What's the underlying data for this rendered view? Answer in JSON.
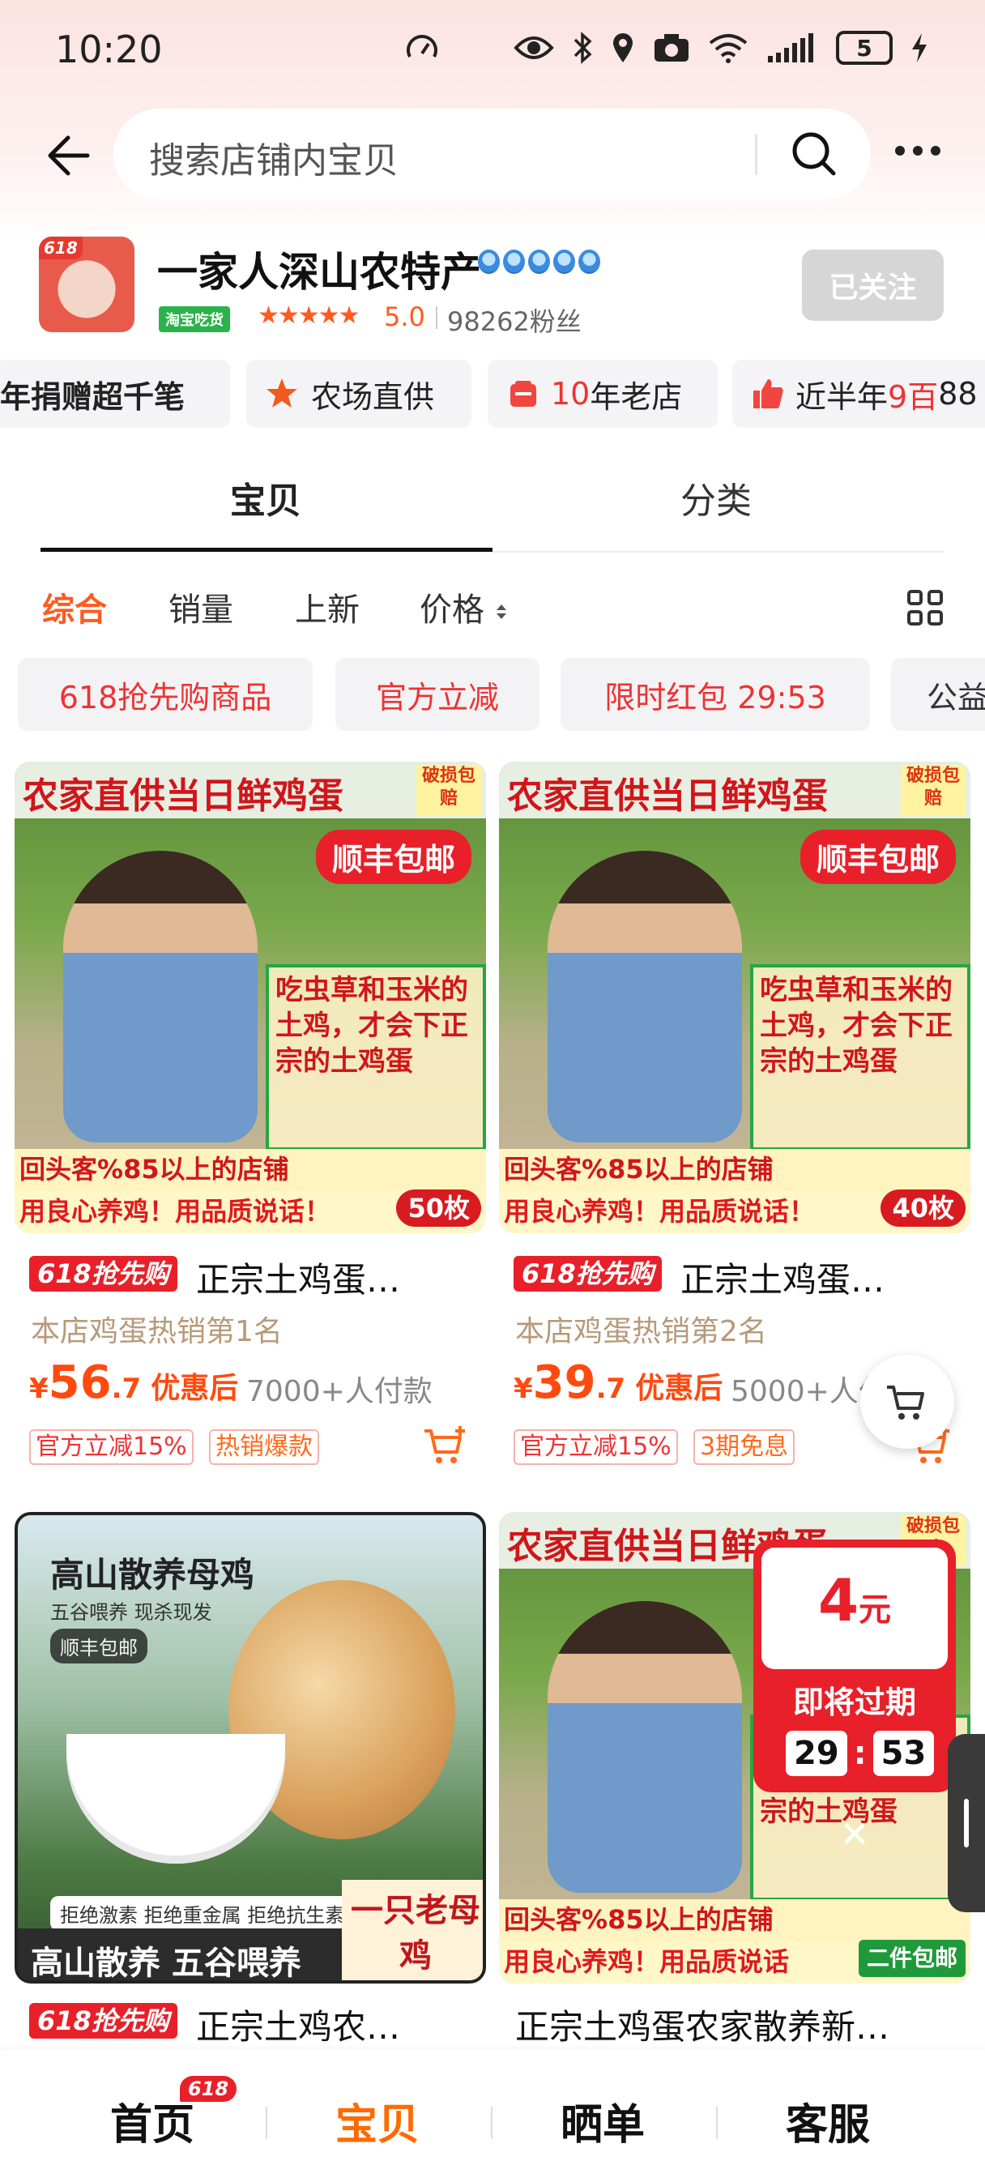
{
  "status_bar": {
    "time": "10:20",
    "battery": "5",
    "icons": [
      "speed-icon",
      "eye-icon",
      "bluetooth-icon",
      "location-icon",
      "camera-icon",
      "wifi-icon",
      "signal-icon",
      "battery-icon",
      "charging-icon"
    ]
  },
  "search": {
    "placeholder": "搜索店铺内宝贝"
  },
  "shop": {
    "logo_tag": "618",
    "name": "一家人深山农特产",
    "badge": "淘宝吃货",
    "stars": "★★★★★",
    "score": "5.0",
    "fans": "98262粉丝",
    "follow_label": "已关注"
  },
  "shop_tags": [
    {
      "label": "年捐赠超千笔"
    },
    {
      "label": "农场直供"
    },
    {
      "label_prefix": "10",
      "label_suffix": "年老店"
    },
    {
      "label_prefix": "近半年",
      "label_highlight": "9百",
      "label_suffix": "88"
    }
  ],
  "tabs": [
    {
      "label": "宝贝",
      "active": true
    },
    {
      "label": "分类",
      "active": false
    }
  ],
  "sort": {
    "items": [
      "综合",
      "销量",
      "上新",
      "价格"
    ],
    "active": "综合"
  },
  "filters": [
    "618抢先购商品",
    "官方立减",
    "限时红包 29:53",
    "公益"
  ],
  "products": [
    {
      "img_banner": "农家直供当日鲜鸡蛋",
      "img_corner": "破损包赔",
      "img_ship": "顺丰包邮",
      "img_box": "吃虫草和玉米的土鸡，才会下正宗的土鸡蛋",
      "img_strip1": "回头客%85以上的店铺",
      "img_strip2": "用良心养鸡！用品质说话！",
      "img_count": "50枚",
      "promo": "618抢先购",
      "title": "正宗土鸡蛋…",
      "rank": "本店鸡蛋热销第1名",
      "price_cur": "¥",
      "price_int": "56",
      "price_dec": ".7",
      "price_after": "优惠后",
      "sold": "7000+人付款",
      "tags": [
        "官方立减15%",
        "热销爆款"
      ]
    },
    {
      "img_banner": "农家直供当日鲜鸡蛋",
      "img_corner": "破损包赔",
      "img_ship": "顺丰包邮",
      "img_box": "吃虫草和玉米的土鸡，才会下正宗的土鸡蛋",
      "img_strip1": "回头客%85以上的店铺",
      "img_strip2": "用良心养鸡！用品质说话！",
      "img_count": "40枚",
      "promo": "618抢先购",
      "title": "正宗土鸡蛋…",
      "rank": "本店鸡蛋热销第2名",
      "price_cur": "¥",
      "price_int": "39",
      "price_dec": ".7",
      "price_after": "优惠后",
      "sold": "5000+人付",
      "tags": [
        "官方立减15%",
        "3期免息"
      ]
    },
    {
      "img_title": "高山散养母鸡",
      "img_sub": "五谷喂养 现杀现发",
      "img_ship": "顺丰包邮",
      "img_strip": "拒绝激素 拒绝重金属 拒绝抗生素",
      "img_bottom": "高山散养 五谷喂养",
      "img_right": "一只老母鸡",
      "promo": "618抢先购",
      "title": "正宗土鸡农…"
    },
    {
      "img_banner": "农家直供当日鲜鸡蛋",
      "img_corner": "破损包赔",
      "img_box": "吃虫草和玉米的土鸡，才会下正宗的土鸡蛋",
      "img_strip1": "回头客%85以上的店铺",
      "img_strip2": "用良心养鸡！用品质说话",
      "img_corner2": "二件包邮",
      "title": "正宗土鸡蛋农家散养新…"
    }
  ],
  "coupon": {
    "amount": "4",
    "unit": "元",
    "label": "即将过期",
    "min": "29",
    "sep": ":",
    "sec": "53"
  },
  "bottom_nav": {
    "items": [
      "首页",
      "宝贝",
      "晒单",
      "客服"
    ],
    "active": "宝贝",
    "badge": "618"
  },
  "colors": {
    "accent": "#ff5a1f",
    "red": "#e8202a",
    "follow_bg": "#d6d6d6"
  }
}
